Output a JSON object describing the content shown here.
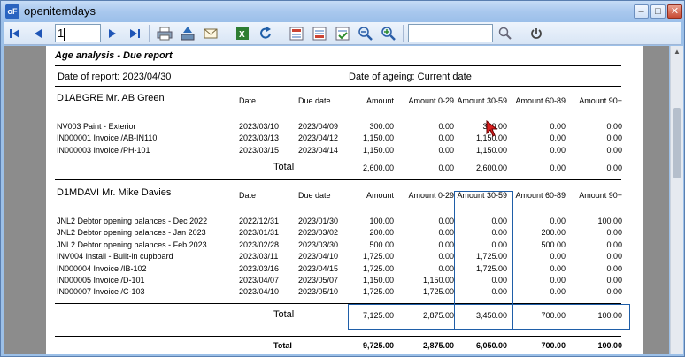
{
  "window": {
    "title": "openitemdays",
    "app_icon": "oF"
  },
  "toolbar": {
    "page_value": "1",
    "search_value": ""
  },
  "report": {
    "title": "Age analysis - Due report",
    "date_of_report": "Date of report:  2023/04/30",
    "date_of_ageing": "Date of ageing: Current date",
    "columns": {
      "date": "Date",
      "due": "Due date",
      "amount": "Amount",
      "a0": "Amount 0-29",
      "a30": "Amount 30-59",
      "a60": "Amount 60-89",
      "a90": "Amount 90+"
    },
    "customers": [
      {
        "name": "D1ABGRE Mr. AB Green",
        "rows": [
          [
            "NV003 Paint - Exterior",
            "2023/03/10",
            "2023/04/09",
            "300.00",
            "0.00",
            "300.00",
            "0.00",
            "0.00"
          ],
          [
            "IN000001 Invoice /AB-IN110",
            "2023/03/13",
            "2023/04/12",
            "1,150.00",
            "0.00",
            "1,150.00",
            "0.00",
            "0.00"
          ],
          [
            "IN000003 Invoice /PH-101",
            "2023/03/15",
            "2023/04/14",
            "1,150.00",
            "0.00",
            "1,150.00",
            "0.00",
            "0.00"
          ]
        ],
        "total_label": "Total",
        "total": "2,600.00",
        "total_a0": "0.00",
        "total_a30": "2,600.00",
        "total_a60": "0.00",
        "total_a90": "0.00"
      },
      {
        "name": "D1MDAVI Mr. Mike Davies",
        "rows": [
          [
            "JNL2 Debtor opening balances - Dec 2022",
            "2022/12/31",
            "2023/01/30",
            "100.00",
            "0.00",
            "0.00",
            "0.00",
            "100.00"
          ],
          [
            "JNL2 Debtor opening balances - Jan 2023",
            "2023/01/31",
            "2023/03/02",
            "200.00",
            "0.00",
            "0.00",
            "200.00",
            "0.00"
          ],
          [
            "JNL2 Debtor opening balances - Feb 2023",
            "2023/02/28",
            "2023/03/30",
            "500.00",
            "0.00",
            "0.00",
            "500.00",
            "0.00"
          ],
          [
            "INV004 Install - Built-in cupboard",
            "2023/03/11",
            "2023/04/10",
            "1,725.00",
            "0.00",
            "1,725.00",
            "0.00",
            "0.00"
          ],
          [
            "IN000004 Invoice /IB-102",
            "2023/03/16",
            "2023/04/15",
            "1,725.00",
            "0.00",
            "1,725.00",
            "0.00",
            "0.00"
          ],
          [
            "IN000005 Invoice /D-101",
            "2023/04/07",
            "2023/05/07",
            "1,150.00",
            "1,150.00",
            "0.00",
            "0.00",
            "0.00"
          ],
          [
            "IN000007 Invoice /C-103",
            "2023/04/10",
            "2023/05/10",
            "1,725.00",
            "1,725.00",
            "0.00",
            "0.00",
            "0.00"
          ]
        ],
        "total_label": "Total",
        "total": "7,125.00",
        "total_a0": "2,875.00",
        "total_a30": "3,450.00",
        "total_a60": "700.00",
        "total_a90": "100.00"
      }
    ],
    "grand_total": {
      "label": "Total",
      "amount": "9,725.00",
      "a0": "2,875.00",
      "a30": "6,050.00",
      "a60": "700.00",
      "a90": "100.00"
    }
  }
}
